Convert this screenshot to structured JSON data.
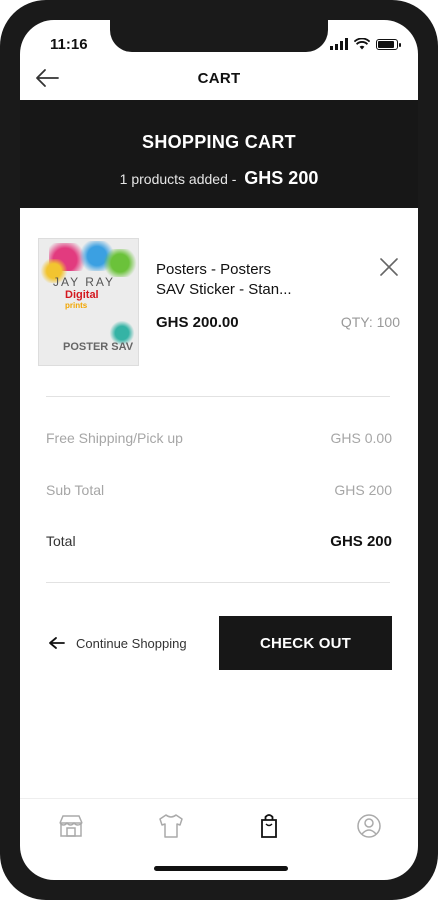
{
  "status_bar": {
    "time": "11:16"
  },
  "nav": {
    "title": "CART"
  },
  "header": {
    "title": "SHOPPING CART",
    "items_added_text": "1 products added -",
    "total_amount": "GHS  200"
  },
  "cart_item": {
    "name_line1": "Posters  - Posters",
    "name_line2": "SAV Sticker - Stan...",
    "price": "GHS 200.00",
    "qty": "QTY: 100",
    "thumb": {
      "brand": "JAY RAY",
      "line1": "Digital",
      "line2": "prints",
      "label": "POSTER SAV"
    }
  },
  "summary": {
    "shipping_label": "Free Shipping/Pick up",
    "shipping_value": "GHS 0.00",
    "subtotal_label": "Sub Total",
    "subtotal_value": "GHS 200",
    "total_label": "Total",
    "total_value": "GHS 200"
  },
  "actions": {
    "continue_label": "Continue Shopping",
    "checkout_label": "CHECK OUT"
  },
  "tabbar": {
    "items": [
      "store-icon",
      "shirt-icon",
      "bag-icon",
      "profile-icon"
    ],
    "active": "bag-icon"
  },
  "colors": {
    "dark": "#171717",
    "muted": "#a6a6a6",
    "bg": "#ffffff"
  }
}
